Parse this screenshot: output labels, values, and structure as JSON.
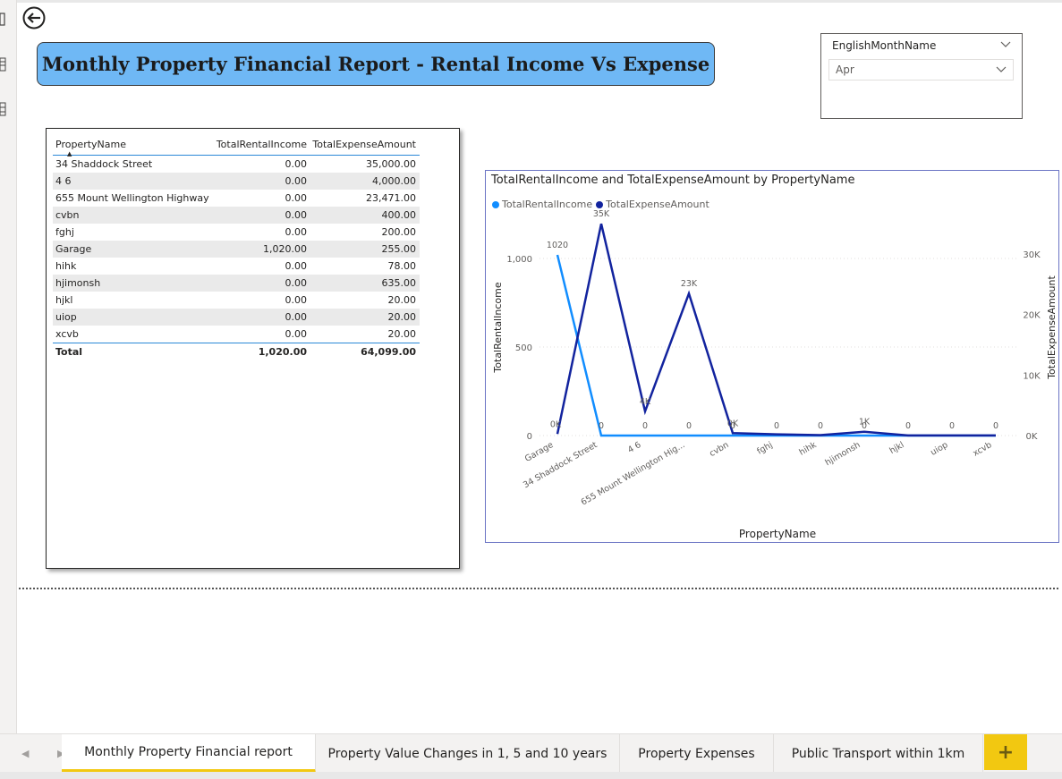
{
  "report_title": "Monthly Property Financial Report - Rental Income Vs Expense",
  "slicer": {
    "field": "EnglishMonthName",
    "selected": "Apr"
  },
  "table": {
    "headers": [
      "PropertyName",
      "TotalRentalIncome",
      "TotalExpenseAmount"
    ],
    "rows": [
      [
        "34 Shaddock Street",
        "0.00",
        "35,000.00"
      ],
      [
        "4 6",
        "0.00",
        "4,000.00"
      ],
      [
        "655 Mount Wellington Highway",
        "0.00",
        "23,471.00"
      ],
      [
        "cvbn",
        "0.00",
        "400.00"
      ],
      [
        "fghj",
        "0.00",
        "200.00"
      ],
      [
        "Garage",
        "1,020.00",
        "255.00"
      ],
      [
        "hihk",
        "0.00",
        "78.00"
      ],
      [
        "hjimonsh",
        "0.00",
        "635.00"
      ],
      [
        "hjkl",
        "0.00",
        "20.00"
      ],
      [
        "uiop",
        "0.00",
        "20.00"
      ],
      [
        "xcvb",
        "0.00",
        "20.00"
      ]
    ],
    "total": [
      "Total",
      "1,020.00",
      "64,099.00"
    ]
  },
  "chart_data": {
    "type": "line",
    "title": "TotalRentalIncome and TotalExpenseAmount by PropertyName",
    "xlabel": "PropertyName",
    "ylabel": "TotalRentalIncome",
    "y2label": "TotalExpenseAmount",
    "categories": [
      "Garage",
      "34 Shaddock Street",
      "4 6",
      "655 Mount Wellington Hig...",
      "cvbn",
      "fghj",
      "hihk",
      "hjimonsh",
      "hjkl",
      "uiop",
      "xcvb"
    ],
    "series": [
      {
        "name": "TotalRentalIncome",
        "axis": "left",
        "color": "#118dff",
        "values": [
          1020,
          0,
          0,
          0,
          0,
          0,
          0,
          0,
          0,
          0,
          0
        ],
        "labels": [
          "1020",
          "0",
          "0",
          "0",
          "0",
          "0",
          "0",
          "0",
          "0",
          "0",
          "0"
        ]
      },
      {
        "name": "TotalExpenseAmount",
        "axis": "right",
        "color": "#12239e",
        "values": [
          255,
          35000,
          4000,
          23471,
          400,
          200,
          78,
          635,
          20,
          20,
          20
        ],
        "labels": [
          "0K",
          "35K",
          "4K",
          "23K",
          "0K",
          "",
          "",
          "1K",
          "",
          "",
          ""
        ]
      }
    ],
    "ylim": [
      0,
      1100
    ],
    "y2lim": [
      0,
      35000
    ],
    "yticks": [
      {
        "v": 0,
        "t": "0"
      },
      {
        "v": 500,
        "t": "500"
      },
      {
        "v": 1000,
        "t": "1,000"
      }
    ],
    "y2ticks": [
      {
        "v": 0,
        "t": "0K"
      },
      {
        "v": 10000,
        "t": "10K"
      },
      {
        "v": 20000,
        "t": "20K"
      },
      {
        "v": 30000,
        "t": "30K"
      }
    ],
    "grid": true,
    "legend": "top-left"
  },
  "tabs": [
    {
      "label": "Monthly Property Financial report",
      "active": true
    },
    {
      "label": "Property Value Changes in 1, 5 and 10 years",
      "active": false
    },
    {
      "label": "Property Expenses",
      "active": false
    },
    {
      "label": "Public Transport within 1km",
      "active": false
    }
  ],
  "add_tab_label": "+",
  "nav_arrows": "◀ ▶",
  "colors": {
    "accent": "#f2c811",
    "title_bg": "#6fb8f5",
    "income": "#118dff",
    "expense": "#12239e"
  }
}
